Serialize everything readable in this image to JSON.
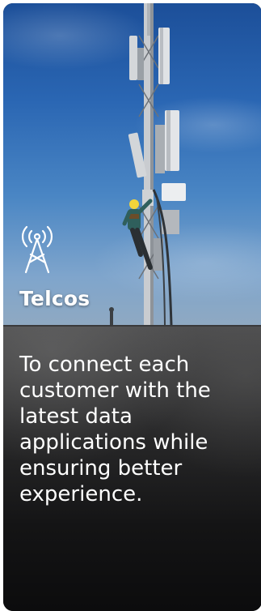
{
  "card": {
    "title": "Telcos",
    "description": "To connect each customer with the latest data applications while ensuring better experience.",
    "icon": "cell-tower-icon",
    "image": "telecom-tower-climber-photo"
  },
  "colors": {
    "text": "#ffffff",
    "panel": "#141415",
    "sky": "#2a66b3"
  }
}
